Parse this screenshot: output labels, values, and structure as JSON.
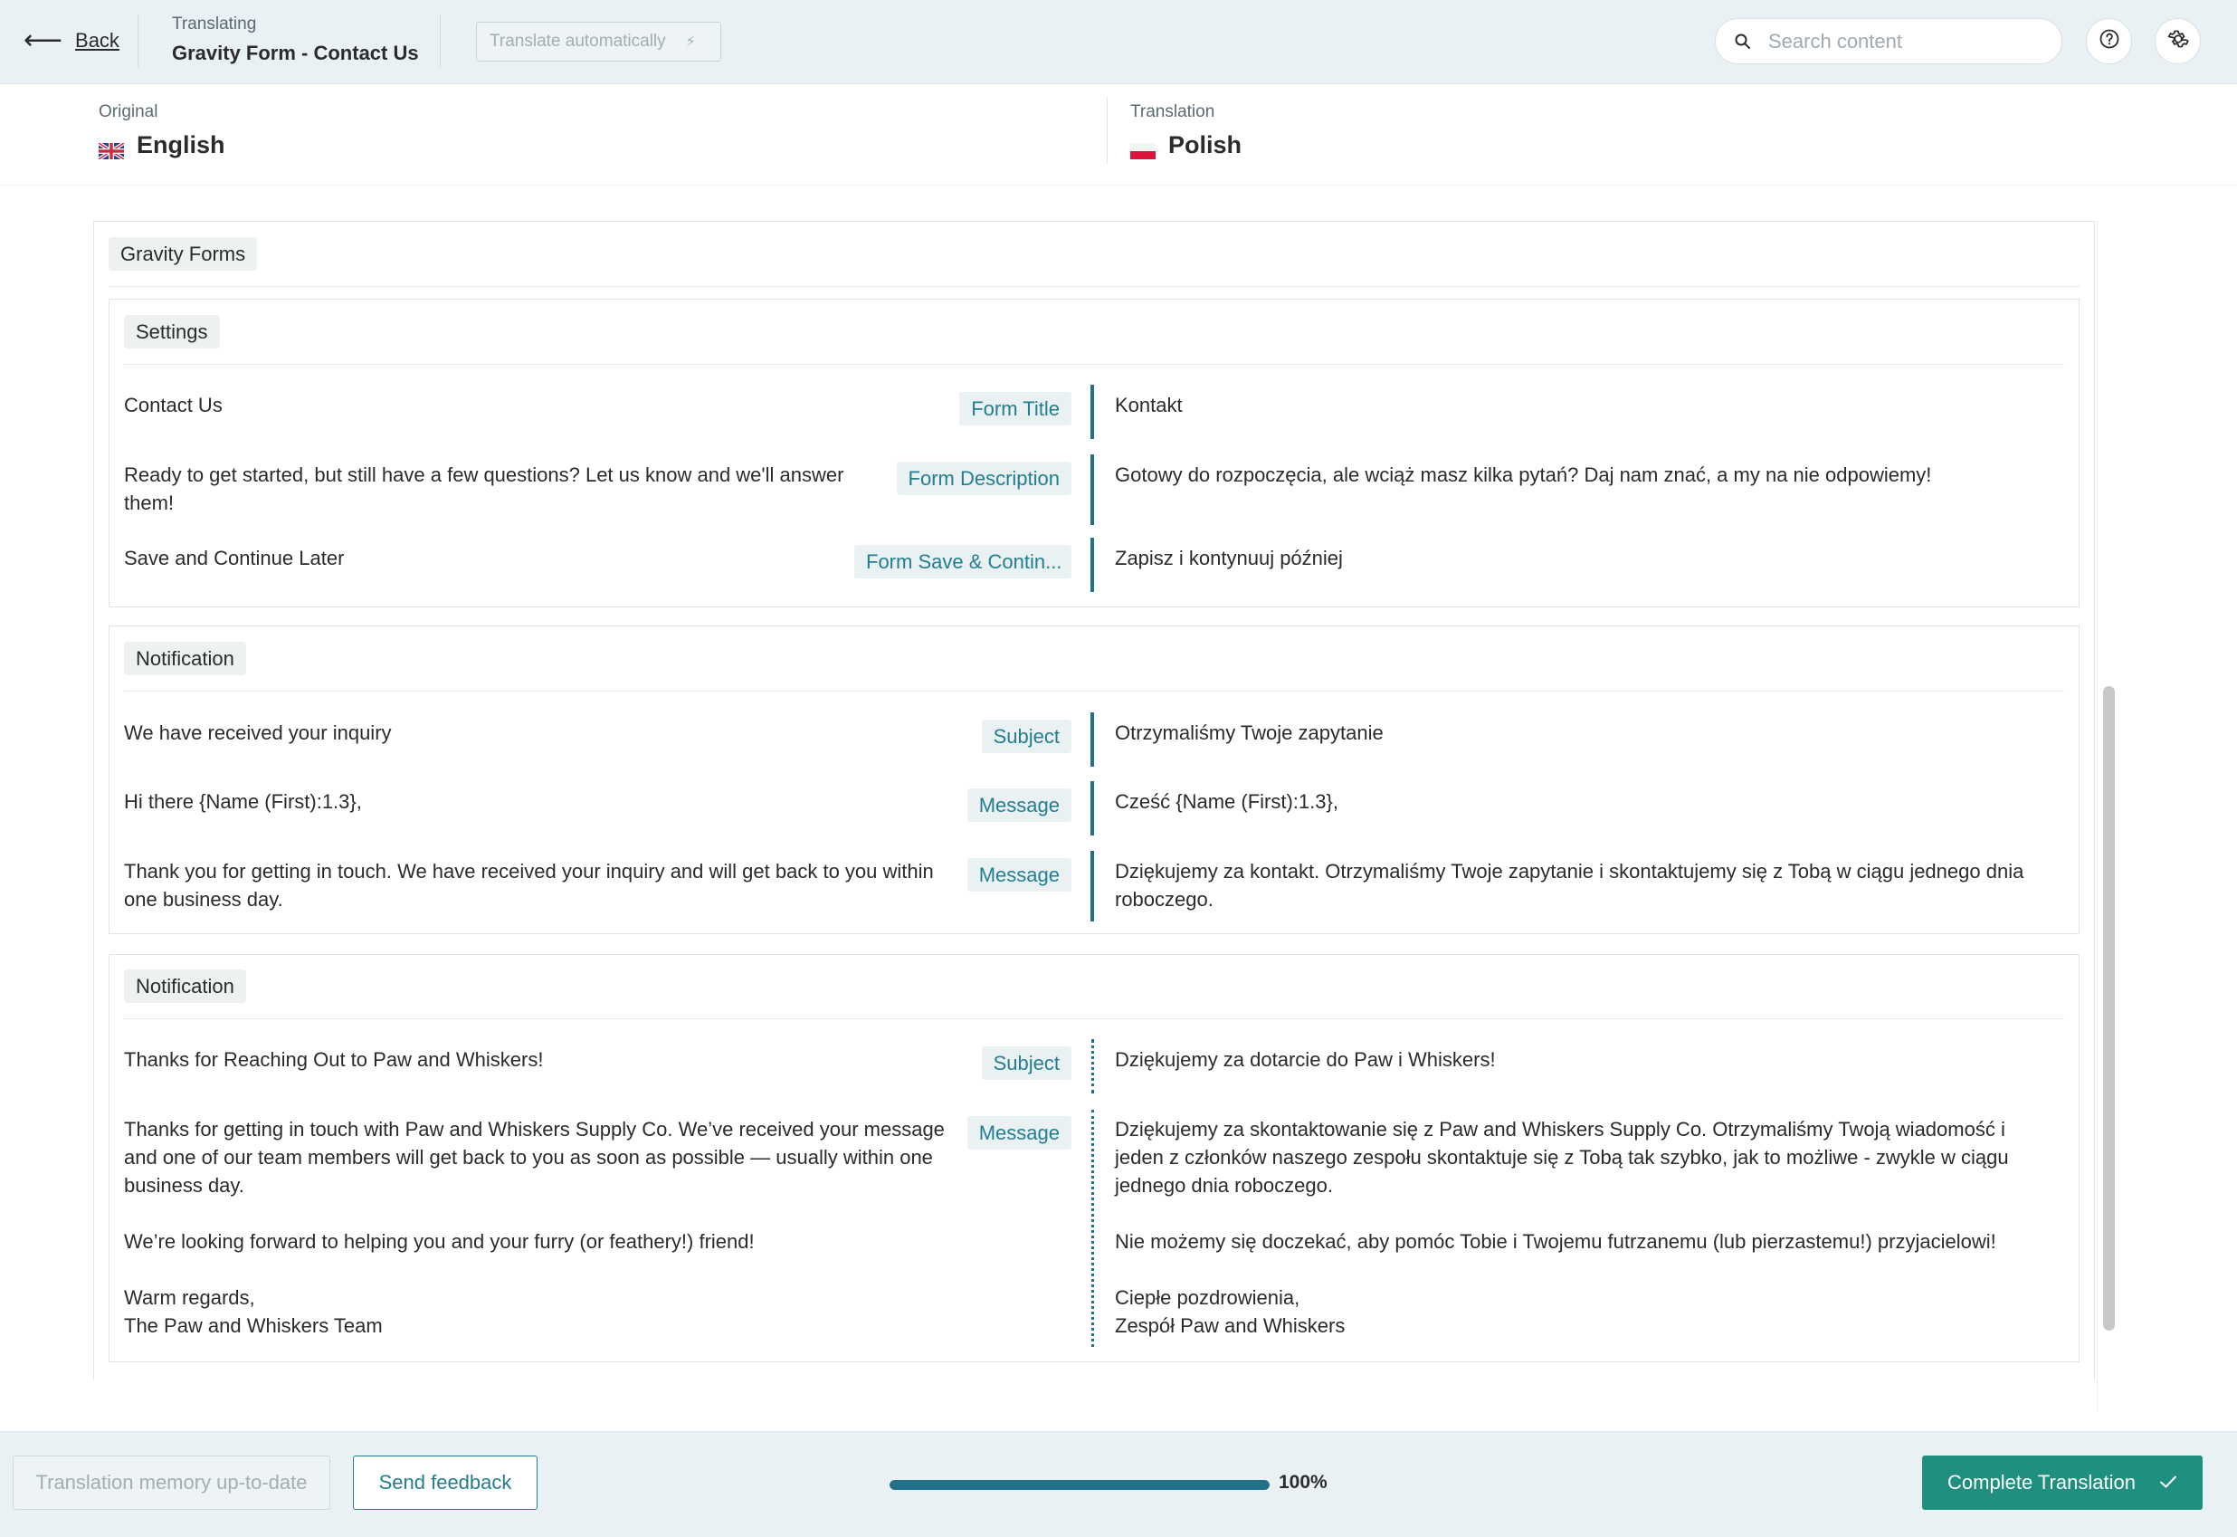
{
  "header": {
    "back_label": "Back",
    "translating_label": "Translating",
    "document_title": "Gravity Form - Contact Us",
    "auto_translate_label": "Translate automatically",
    "search_placeholder": "Search content"
  },
  "languages": {
    "original_label": "Original",
    "original_name": "English",
    "translation_label": "Translation",
    "translation_name": "Polish"
  },
  "group_title": "Gravity Forms",
  "sections": [
    {
      "title": "Settings",
      "rows": [
        {
          "source": "Contact Us",
          "field": "Form Title",
          "target": "Kontakt"
        },
        {
          "source": "Ready to get started, but still have a few questions? Let us know and we'll answer them!",
          "field": "Form Description",
          "target": "Gotowy do rozpoczęcia, ale wciąż masz kilka pytań? Daj nam znać, a my na nie odpowiemy!"
        },
        {
          "source": "Save and Continue Later",
          "field": "Form Save & Contin...",
          "target": "Zapisz i kontynuuj później"
        }
      ]
    },
    {
      "title": "Notification",
      "rows": [
        {
          "source": "We have received your inquiry",
          "field": "Subject",
          "target": "Otrzymaliśmy Twoje zapytanie"
        },
        {
          "source": "Hi there {Name (First):1.3},",
          "field": "Message",
          "target": "Cześć {Name (First):1.3},"
        },
        {
          "source": "Thank you for getting in touch. We have received your inquiry and will get back to you within one business day.",
          "field": "Message",
          "target": "Dziękujemy za kontakt. Otrzymaliśmy Twoje zapytanie i skontaktujemy się z Tobą w ciągu jednego dnia roboczego."
        }
      ]
    },
    {
      "title": "Notification",
      "rows": [
        {
          "source": "Thanks for Reaching Out to Paw and Whiskers!",
          "field": "Subject",
          "target": "Dziękujemy za dotarcie do Paw i Whiskers!"
        },
        {
          "source_p1": "Thanks for getting in touch with Paw and Whiskers Supply Co. We’ve received your message and one of our team members will get back to you as soon as possible — usually within one business day.",
          "source_p2": "We’re looking forward to helping you and your furry (or feathery!) friend!",
          "source_p3a": "Warm regards,",
          "source_p3b": "The Paw and Whiskers Team",
          "field": "Message",
          "target_p1": "Dziękujemy za skontaktowanie się z Paw and Whiskers Supply Co. Otrzymaliśmy Twoją wiadomość i jeden z członków naszego zespołu skontaktuje się z Tobą tak szybko, jak to możliwe - zwykle w ciągu jednego dnia roboczego.",
          "target_p2": "Nie możemy się doczekać, aby pomóc Tobie i Twojemu futrzanemu (lub pierzastemu!) przyjacielowi!",
          "target_p3a": "Ciepłe pozdrowienia,",
          "target_p3b": "Zespół Paw and Whiskers"
        }
      ]
    }
  ],
  "footer": {
    "memory_label": "Translation memory up-to-date",
    "feedback_label": "Send feedback",
    "progress_percent": 100,
    "progress_text": "100%",
    "complete_label": "Complete Translation"
  },
  "colors": {
    "accent": "#23708a",
    "primary_button": "#1f8f7f",
    "topbar_bg": "#eaf1f4"
  },
  "icons": [
    "back-arrow-icon",
    "bolt-icon",
    "search-icon",
    "help-icon",
    "gear-icon",
    "uk-flag-icon",
    "poland-flag-icon",
    "checkmark-icon"
  ]
}
